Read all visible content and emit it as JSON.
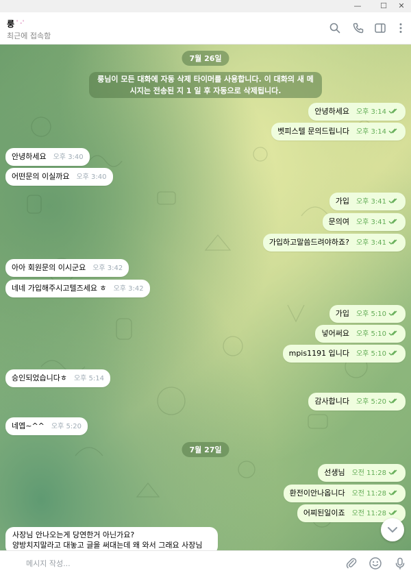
{
  "window": {
    "minimize": "—",
    "maximize": "☐",
    "close": "✕"
  },
  "header": {
    "title": "룽",
    "title_emoji": "ﾟ･ﾟ",
    "status": "최근에 접속함",
    "icons": [
      "search-icon",
      "phone-icon",
      "sidebar-icon",
      "more-icon"
    ]
  },
  "chat": {
    "date1": "7월 26일",
    "service_message": "룽님이 모든 대화에 자동 삭제 타이머를 사용합니다. 이 대화의 새 메시지는 전송된 지 1 일 후 자동으로 삭제됩니다.",
    "date2": "7월 27일",
    "messages": [
      {
        "dir": "out",
        "text": "안녕하세요",
        "time": "오후 3:14"
      },
      {
        "dir": "out",
        "text": "벳피스텔 문의드립니다",
        "time": "오후 3:14"
      },
      {
        "dir": "in",
        "text": "안녕하세요",
        "time": "오후 3:40"
      },
      {
        "dir": "in",
        "text": "어떤문의 이실까요",
        "time": "오후 3:40"
      },
      {
        "dir": "out",
        "text": "가입",
        "time": "오후 3:41"
      },
      {
        "dir": "out",
        "text": "문의여",
        "time": "오후 3:41"
      },
      {
        "dir": "out",
        "text": "가입하고말씀드려야하죠?",
        "time": "오후 3:41"
      },
      {
        "dir": "in",
        "text": "아아 회원문의 이시군요",
        "time": "오후 3:42"
      },
      {
        "dir": "in",
        "text": "네네 가입해주시고텔즈세요 ㅎ",
        "time": "오후 3:42"
      },
      {
        "dir": "out",
        "text": "가입",
        "time": "오후 5:10"
      },
      {
        "dir": "out",
        "text": "넣어써요",
        "time": "오후 5:10"
      },
      {
        "dir": "out",
        "text": "mpis1191 입니다",
        "time": "오후 5:10"
      },
      {
        "dir": "in",
        "text": "승인되었습니다ㅎ",
        "time": "오후 5:14"
      },
      {
        "dir": "out",
        "text": "감사합니다",
        "time": "오후 5:20"
      },
      {
        "dir": "in",
        "text": "네엡~^^",
        "time": "오후 5:20"
      },
      {
        "dir": "out",
        "text": "선생님",
        "time": "오전 11:28"
      },
      {
        "dir": "out",
        "text": "환전이안나옵니다",
        "time": "오전 11:28"
      },
      {
        "dir": "out",
        "text": "어찌된일이죠",
        "time": "오전 11:28"
      }
    ],
    "last_message_lines": [
      "사장님 안나오는게 당연한거 아닌가요?",
      "양방치지말라고 대놓고 글을 써대는데 왜 와서 그래요 사장님"
    ]
  },
  "composer": {
    "placeholder": "메시지 작성...",
    "icons": [
      "attach-icon",
      "emoji-icon",
      "microphone-icon"
    ]
  },
  "colors": {
    "outgoing_bubble": "#effdde",
    "incoming_bubble": "#ffffff",
    "outgoing_time": "#62ac55",
    "date_pill": "#567a48"
  }
}
